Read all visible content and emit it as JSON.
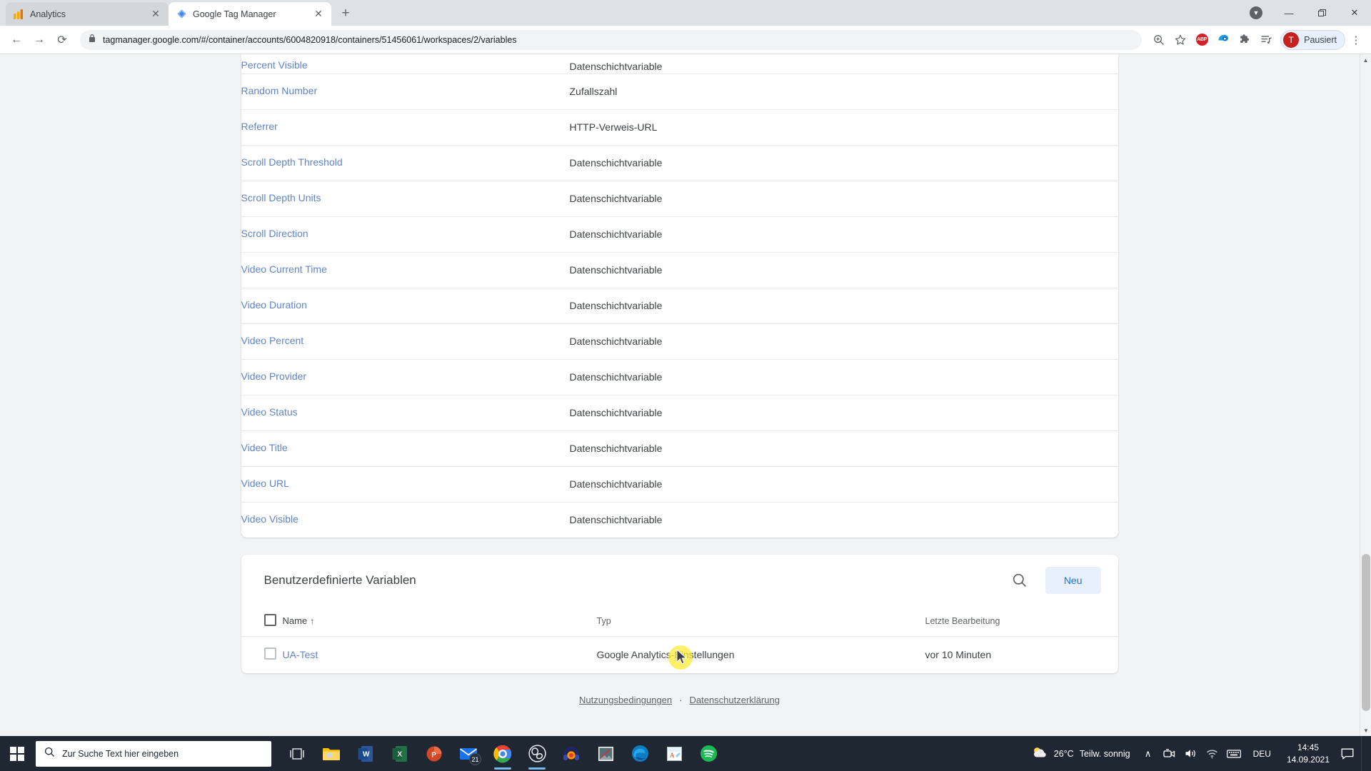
{
  "browser": {
    "tabs": [
      {
        "title": "Analytics",
        "favicon": "analytics-icon",
        "active": false
      },
      {
        "title": "Google Tag Manager",
        "favicon": "tag-manager-icon",
        "active": true
      }
    ],
    "new_tab_label": "+",
    "window_controls": {
      "minimize": "—",
      "restore": "❐",
      "close": "✕"
    },
    "nav": {
      "back": "←",
      "forward": "→",
      "reload": "⟳"
    },
    "omnibox": {
      "lock_icon": "lock-icon",
      "url": "tagmanager.google.com/#/container/accounts/6004820918/containers/51456061/workspaces/2/variables"
    },
    "toolbar_icons": [
      "zoom-in-icon",
      "bookmark-star-icon",
      "adblock-plus-icon",
      "extension-blue-icon",
      "extensions-puzzle-icon",
      "reading-list-icon"
    ],
    "adblock_label": "ABP",
    "profile": {
      "initial": "T",
      "label": "Pausiert"
    },
    "menu_icon": "three-dot-menu-icon"
  },
  "builtin_variables": {
    "rows": [
      {
        "name": "Percent Visible",
        "type": "Datenschichtvariable"
      },
      {
        "name": "Random Number",
        "type": "Zufallszahl"
      },
      {
        "name": "Referrer",
        "type": "HTTP-Verweis-URL"
      },
      {
        "name": "Scroll Depth Threshold",
        "type": "Datenschichtvariable"
      },
      {
        "name": "Scroll Depth Units",
        "type": "Datenschichtvariable"
      },
      {
        "name": "Scroll Direction",
        "type": "Datenschichtvariable"
      },
      {
        "name": "Video Current Time",
        "type": "Datenschichtvariable"
      },
      {
        "name": "Video Duration",
        "type": "Datenschichtvariable"
      },
      {
        "name": "Video Percent",
        "type": "Datenschichtvariable"
      },
      {
        "name": "Video Provider",
        "type": "Datenschichtvariable"
      },
      {
        "name": "Video Status",
        "type": "Datenschichtvariable"
      },
      {
        "name": "Video Title",
        "type": "Datenschichtvariable"
      },
      {
        "name": "Video URL",
        "type": "Datenschichtvariable"
      },
      {
        "name": "Video Visible",
        "type": "Datenschichtvariable"
      }
    ]
  },
  "custom_variables": {
    "title": "Benutzerdefinierte Variablen",
    "search_icon": "search-icon",
    "new_button": "Neu",
    "columns": {
      "name": "Name",
      "sort_arrow": "↑",
      "type": "Typ",
      "last_edit": "Letzte Bearbeitung"
    },
    "rows": [
      {
        "name": "UA-Test",
        "type": "Google Analytics-Einstellungen",
        "last_edit": "vor 10 Minuten"
      }
    ]
  },
  "footer": {
    "terms": "Nutzungsbedingungen",
    "separator": "·",
    "privacy": "Datenschutzerklärung"
  },
  "taskbar": {
    "start_icon": "windows-start-icon",
    "search_placeholder": "Zur Suche Text hier eingeben",
    "search_icon": "search-icon",
    "apps": [
      {
        "name": "task-view-icon"
      },
      {
        "name": "file-explorer-icon"
      },
      {
        "name": "word-icon"
      },
      {
        "name": "excel-icon"
      },
      {
        "name": "powerpoint-icon"
      },
      {
        "name": "mail-icon",
        "badge": "21"
      },
      {
        "name": "chrome-icon"
      },
      {
        "name": "obs-icon"
      },
      {
        "name": "headphones-icon"
      },
      {
        "name": "photos-icon"
      },
      {
        "name": "edge-icon"
      },
      {
        "name": "paint-icon"
      },
      {
        "name": "spotify-icon"
      }
    ],
    "tray": {
      "weather_temp": "26°C",
      "weather_desc": "Teilw. sonnig",
      "chevron": "∧",
      "icons": [
        "camera-icon",
        "volume-icon",
        "wifi-icon",
        "keyboard-icon"
      ],
      "language": "DEU",
      "time": "14:45",
      "date": "14.09.2021",
      "notification_icon": "notification-icon"
    }
  },
  "colors": {
    "link_blue": "#5f84c8",
    "accent_blue": "#1a73e8",
    "neu_bg": "#e8f0fe",
    "page_bg": "#f1f3f4",
    "taskbar": "#1f2733"
  }
}
